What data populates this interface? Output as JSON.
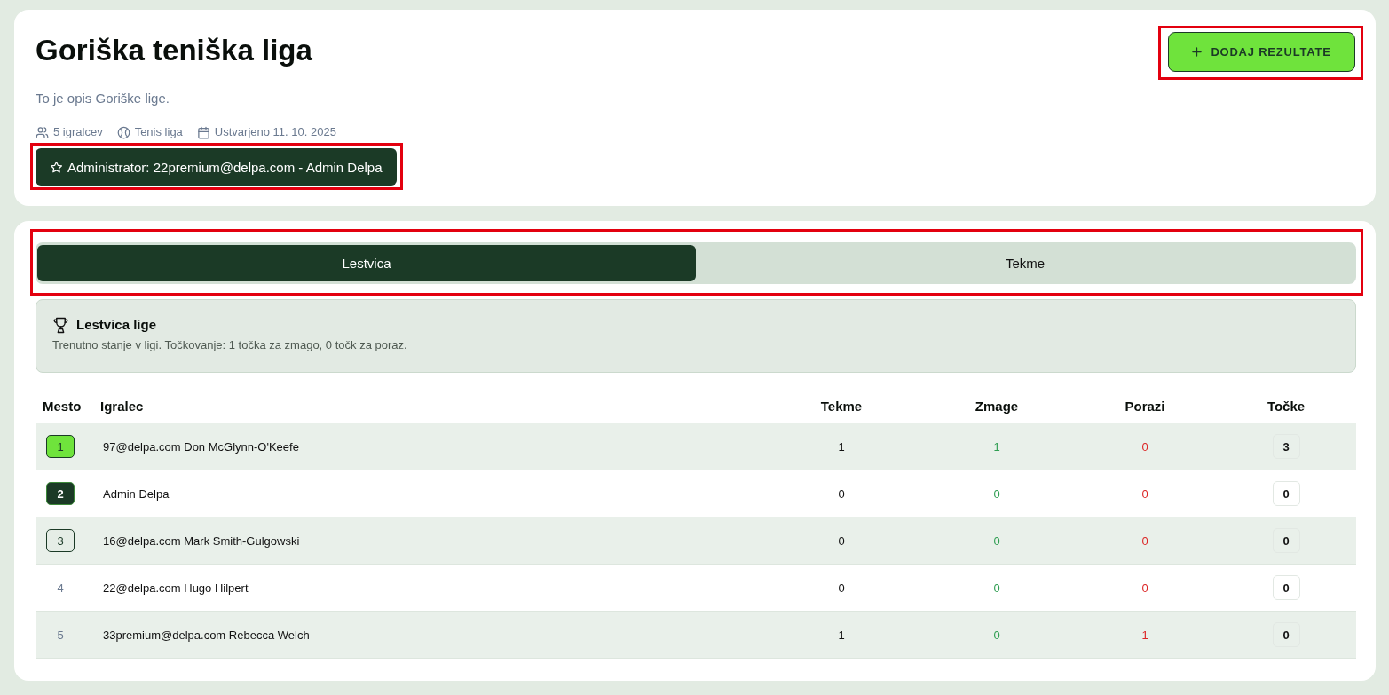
{
  "header": {
    "title": "Goriška teniška liga",
    "description": "To je opis Goriške lige.",
    "meta": [
      {
        "kind": "players",
        "text": "5 igralcev"
      },
      {
        "kind": "sport",
        "text": "Tenis liga"
      },
      {
        "kind": "created",
        "text": "Ustvarjeno 11. 10. 2025"
      }
    ],
    "admin_badge": {
      "text": "Administrator: 22premium@delpa.com - Admin Delpa",
      "highlighted": true
    },
    "action_button": {
      "label": "DODAJ REZULTATE",
      "highlighted": true
    }
  },
  "tabs": {
    "highlighted": true,
    "items": [
      {
        "label": "Lestvica",
        "selected": true
      },
      {
        "label": "Tekme",
        "selected": false
      }
    ]
  },
  "standings": {
    "title": "Lestvica lige",
    "subtitle": "Trenutno stanje v ligi. Točkovanje: 1 točka za zmago, 0 točk za poraz."
  },
  "table": {
    "columns": [
      "Mesto",
      "Igralec",
      "Tekme",
      "Zmage",
      "Porazi",
      "Točke"
    ],
    "rows": [
      {
        "kind": "first",
        "rank": "1",
        "player": "97@delpa.com Don McGlynn-O'Keefe",
        "matches": "1",
        "wins": "1",
        "losses": "0",
        "points": "3"
      },
      {
        "kind": "second",
        "rank": "2",
        "player": "Admin Delpa",
        "matches": "0",
        "wins": "0",
        "losses": "0",
        "points": "0"
      },
      {
        "kind": "third",
        "rank": "3",
        "player": "16@delpa.com Mark Smith-Gulgowski",
        "matches": "0",
        "wins": "0",
        "losses": "0",
        "points": "0"
      },
      {
        "kind": "plain",
        "rank": "4",
        "player": "22@delpa.com Hugo Hilpert",
        "matches": "0",
        "wins": "0",
        "losses": "0",
        "points": "0"
      },
      {
        "kind": "plain",
        "rank": "5",
        "player": "33premium@delpa.com Rebecca Welch",
        "matches": "1",
        "wins": "0",
        "losses": "1",
        "points": "0"
      }
    ]
  }
}
